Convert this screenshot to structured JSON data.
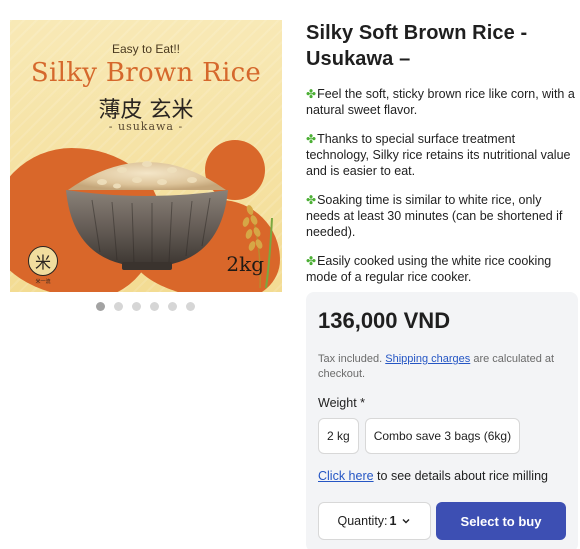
{
  "image": {
    "tagline": "Easy to Eat!!",
    "title": "Silky Brown Rice",
    "japanese": "薄皮 玄米",
    "romaji": "- usukawa -",
    "weight": "2kg",
    "logo_char": "米",
    "logo_text": "米一流",
    "colors": {
      "background": "#f6e3a7",
      "accent": "#d9672a",
      "title": "#d5682c"
    }
  },
  "carousel": {
    "total": 6,
    "active_index": 0
  },
  "product": {
    "title": "Silky Soft Brown Rice - Usukawa –",
    "feature_icon": "four-leaf-clover-icon",
    "features": [
      "Feel the soft, sticky brown rice like corn, with a natural sweet flavor.",
      "Thanks to special surface treatment technology, Silky rice retains its nutritional value and is easier to eat.",
      "Soaking time is similar to white rice, only needs at least 30 minutes (can be shortened if needed).",
      "Easily cooked using the white rice cooking mode of a regular rice cooker."
    ]
  },
  "purchase": {
    "price": "136,000 VND",
    "tax_prefix": "Tax included. ",
    "shipping_link": "Shipping charges",
    "tax_suffix": " are calculated at checkout.",
    "weight_label": "Weight *",
    "variants": [
      "2 kg",
      "Combo save 3 bags (6kg)"
    ],
    "milling_link": "Click here",
    "milling_suffix": " to see details about rice milling",
    "quantity_label": "Quantity: ",
    "quantity_value": "1",
    "buy_label": "Select to buy",
    "colors": {
      "buy_button": "#3d4fb3",
      "link": "#2556c4",
      "panel": "#f3f4f6"
    }
  }
}
